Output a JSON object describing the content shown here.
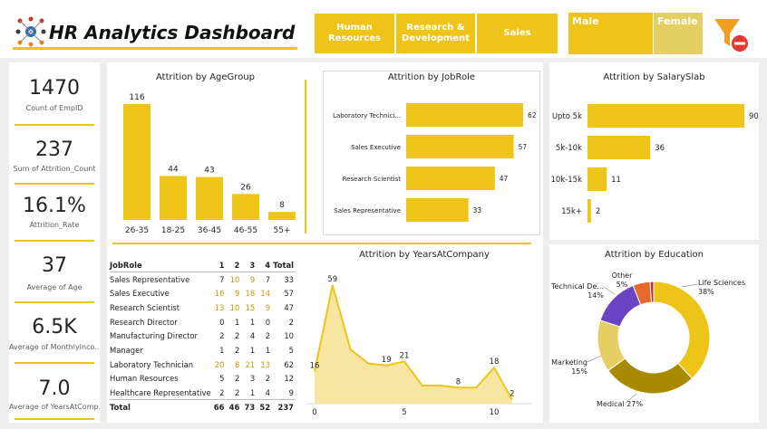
{
  "header": {
    "title": "HR Analytics Dashboard",
    "departments": [
      "Human Resources",
      "Research & Development",
      "Sales"
    ],
    "genders": [
      "Male",
      "Female"
    ]
  },
  "kpis": [
    {
      "value": "1470",
      "label": "Count of EmpID"
    },
    {
      "value": "237",
      "label": "Sum of Attrition_Count"
    },
    {
      "value": "16.1%",
      "label": "Attrition_Rate"
    },
    {
      "value": "37",
      "label": "Average of Age"
    },
    {
      "value": "6.5K",
      "label": "Average of MonthlyInco..."
    },
    {
      "value": "7.0",
      "label": "Average of YearsAtComp..."
    }
  ],
  "colors": {
    "accent": "#efc419",
    "accent_light": "#e6cf62",
    "dark_gold": "#a88b00",
    "purple": "#6a44c2",
    "orange": "#e56a2c",
    "red": "#b3303a"
  },
  "chart_data": [
    {
      "type": "bar",
      "title": "Attrition by AgeGroup",
      "categories": [
        "26-35",
        "18-25",
        "36-45",
        "46-55",
        "55+"
      ],
      "values": [
        116,
        44,
        43,
        26,
        8
      ],
      "ylim": [
        0,
        116
      ]
    },
    {
      "type": "bar",
      "orientation": "horizontal",
      "title": "Attrition by JobRole",
      "categories": [
        "Laboratory Technici...",
        "Sales Executive",
        "Research Scientist",
        "Sales Representative"
      ],
      "values": [
        62,
        57,
        47,
        33
      ],
      "xlim": [
        0,
        62
      ]
    },
    {
      "type": "bar",
      "orientation": "horizontal",
      "title": "Attrition by SalarySlab",
      "categories": [
        "Upto 5k",
        "5k-10k",
        "10k-15k",
        "15k+"
      ],
      "values": [
        90,
        36,
        11,
        2
      ],
      "xlim": [
        0,
        90
      ]
    },
    {
      "type": "area",
      "title": "Attrition by YearsAtCompany",
      "x": [
        0,
        1,
        2,
        3,
        4,
        5,
        6,
        7,
        8,
        9,
        10,
        11
      ],
      "y": [
        16,
        59,
        27,
        20,
        19,
        21,
        9,
        9,
        8,
        8,
        18,
        2
      ],
      "labels": {
        "0": "16",
        "1": "59",
        "4": "19",
        "5": "21",
        "8": "8",
        "10": "18",
        "11": "2"
      },
      "xticks": [
        "0",
        "5",
        "10"
      ],
      "ylim": [
        0,
        64
      ]
    },
    {
      "type": "pie",
      "donut": true,
      "title": "Attrition by Education",
      "slices": [
        {
          "name": "Life Sciences",
          "pct": 38,
          "label": "Life Sciences\n38%",
          "color": "#efc419"
        },
        {
          "name": "Medical",
          "pct": 27,
          "label": "Medical 27%",
          "color": "#a88b00"
        },
        {
          "name": "Marketing",
          "pct": 15,
          "label": "Marketing\n15%",
          "color": "#e6cf62"
        },
        {
          "name": "Technical De...",
          "pct": 14,
          "label": "Technical De...\n14%",
          "color": "#6a44c2"
        },
        {
          "name": "Other",
          "pct": 5,
          "label": "Other\n5%",
          "color": "#e56a2c"
        },
        {
          "name": "",
          "pct": 1,
          "label": "",
          "color": "#b3303a"
        }
      ]
    },
    {
      "type": "table",
      "columns": [
        "JobRole",
        "1",
        "2",
        "3",
        "4",
        "Total"
      ],
      "rows": [
        [
          "Sales Representative",
          "7",
          "10",
          "9",
          "7",
          "33"
        ],
        [
          "Sales Executive",
          "16",
          "9",
          "18",
          "14",
          "57"
        ],
        [
          "Research Scientist",
          "13",
          "10",
          "15",
          "9",
          "47"
        ],
        [
          "Research Director",
          "0",
          "1",
          "1",
          "0",
          "2"
        ],
        [
          "Manufacturing Director",
          "2",
          "2",
          "4",
          "2",
          "10"
        ],
        [
          "Manager",
          "1",
          "2",
          "1",
          "1",
          "5"
        ],
        [
          "Laboratory Technician",
          "20",
          "8",
          "21",
          "13",
          "62"
        ],
        [
          "Human Resources",
          "5",
          "2",
          "3",
          "2",
          "12"
        ],
        [
          "Healthcare Representative",
          "2",
          "2",
          "1",
          "4",
          "9"
        ]
      ],
      "total": [
        "Total",
        "66",
        "46",
        "73",
        "52",
        "237"
      ]
    }
  ]
}
